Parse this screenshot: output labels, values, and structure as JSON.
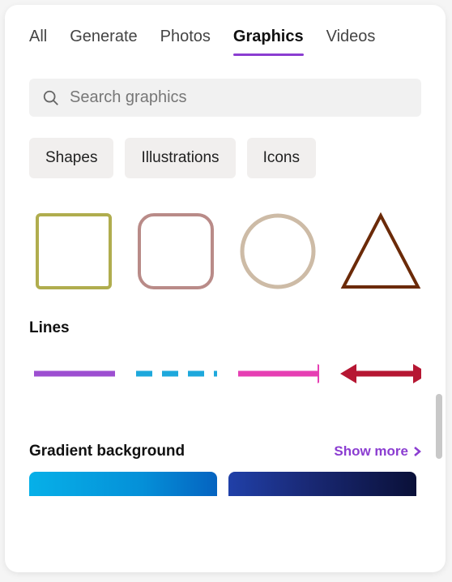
{
  "tabs": {
    "items": [
      {
        "label": "All"
      },
      {
        "label": "Generate"
      },
      {
        "label": "Photos"
      },
      {
        "label": "Graphics"
      },
      {
        "label": "Videos"
      }
    ],
    "active_index": 3
  },
  "search": {
    "placeholder": "Search graphics"
  },
  "filters": [
    {
      "label": "Shapes"
    },
    {
      "label": "Illustrations"
    },
    {
      "label": "Icons"
    }
  ],
  "shapes": [
    {
      "name": "square",
      "stroke": "#b0ad4e"
    },
    {
      "name": "rounded-square",
      "stroke": "#b98b88"
    },
    {
      "name": "circle",
      "stroke": "#cdbba6"
    },
    {
      "name": "triangle",
      "stroke": "#6b2a08"
    }
  ],
  "sections": {
    "lines_title": "Lines",
    "gradient_title": "Gradient background",
    "show_more_label": "Show more"
  },
  "lines": [
    {
      "name": "solid-line",
      "color": "#9d4fd1"
    },
    {
      "name": "dashed-line",
      "color": "#1ea8dc"
    },
    {
      "name": "arrow-right",
      "color": "#e63fb3"
    },
    {
      "name": "arrow-double",
      "color": "#b61733"
    }
  ]
}
